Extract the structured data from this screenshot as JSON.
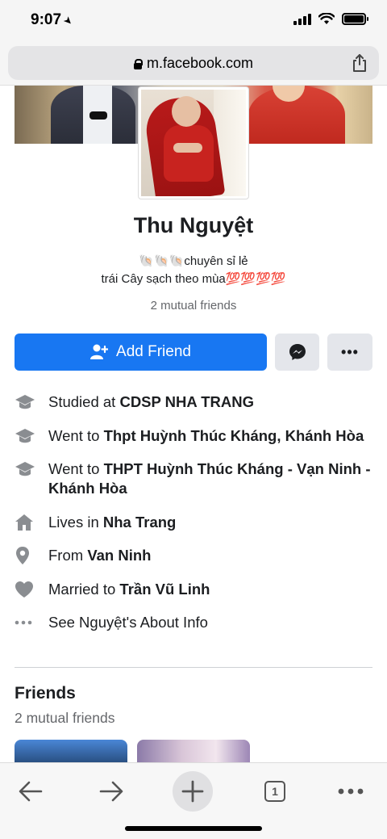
{
  "status_bar": {
    "time": "9:07"
  },
  "browser": {
    "url": "m.facebook.com"
  },
  "profile": {
    "name": "Thu Nguyệt",
    "bio_line1": "🐚🐚🐚chuyên sỉ lẻ",
    "bio_line2": "trái Cây sạch theo mùa💯💯💯💯",
    "mutual_friends": "2 mutual friends"
  },
  "actions": {
    "add_friend_label": "Add Friend",
    "more_label": "•••"
  },
  "info": [
    {
      "prefix": "Studied at ",
      "value": "CDSP NHA TRANG",
      "icon": "graduation-cap-icon"
    },
    {
      "prefix": "Went to ",
      "value": "Thpt Huỳnh Thúc Kháng, Khánh Hòa",
      "icon": "graduation-cap-icon"
    },
    {
      "prefix": "Went to ",
      "value": "THPT Huỳnh Thúc Kháng - Vạn Ninh - Khánh Hòa",
      "icon": "graduation-cap-icon"
    },
    {
      "prefix": "Lives in ",
      "value": "Nha Trang",
      "icon": "home-icon"
    },
    {
      "prefix": "From ",
      "value": "Van Ninh",
      "icon": "location-pin-icon"
    },
    {
      "prefix": "Married to ",
      "value": "Trần Vũ Linh",
      "icon": "heart-icon"
    },
    {
      "prefix": "See Nguyệt's About Info",
      "value": "",
      "icon": "more-dots-icon"
    }
  ],
  "friends": {
    "title": "Friends",
    "subtitle": "2 mutual friends"
  },
  "bottom_bar": {
    "tab_count": "1"
  },
  "colors": {
    "primary": "#1877f2",
    "secondary_button": "#e4e6eb",
    "muted_text": "#65676b",
    "icon_gray": "#8a8d91"
  }
}
